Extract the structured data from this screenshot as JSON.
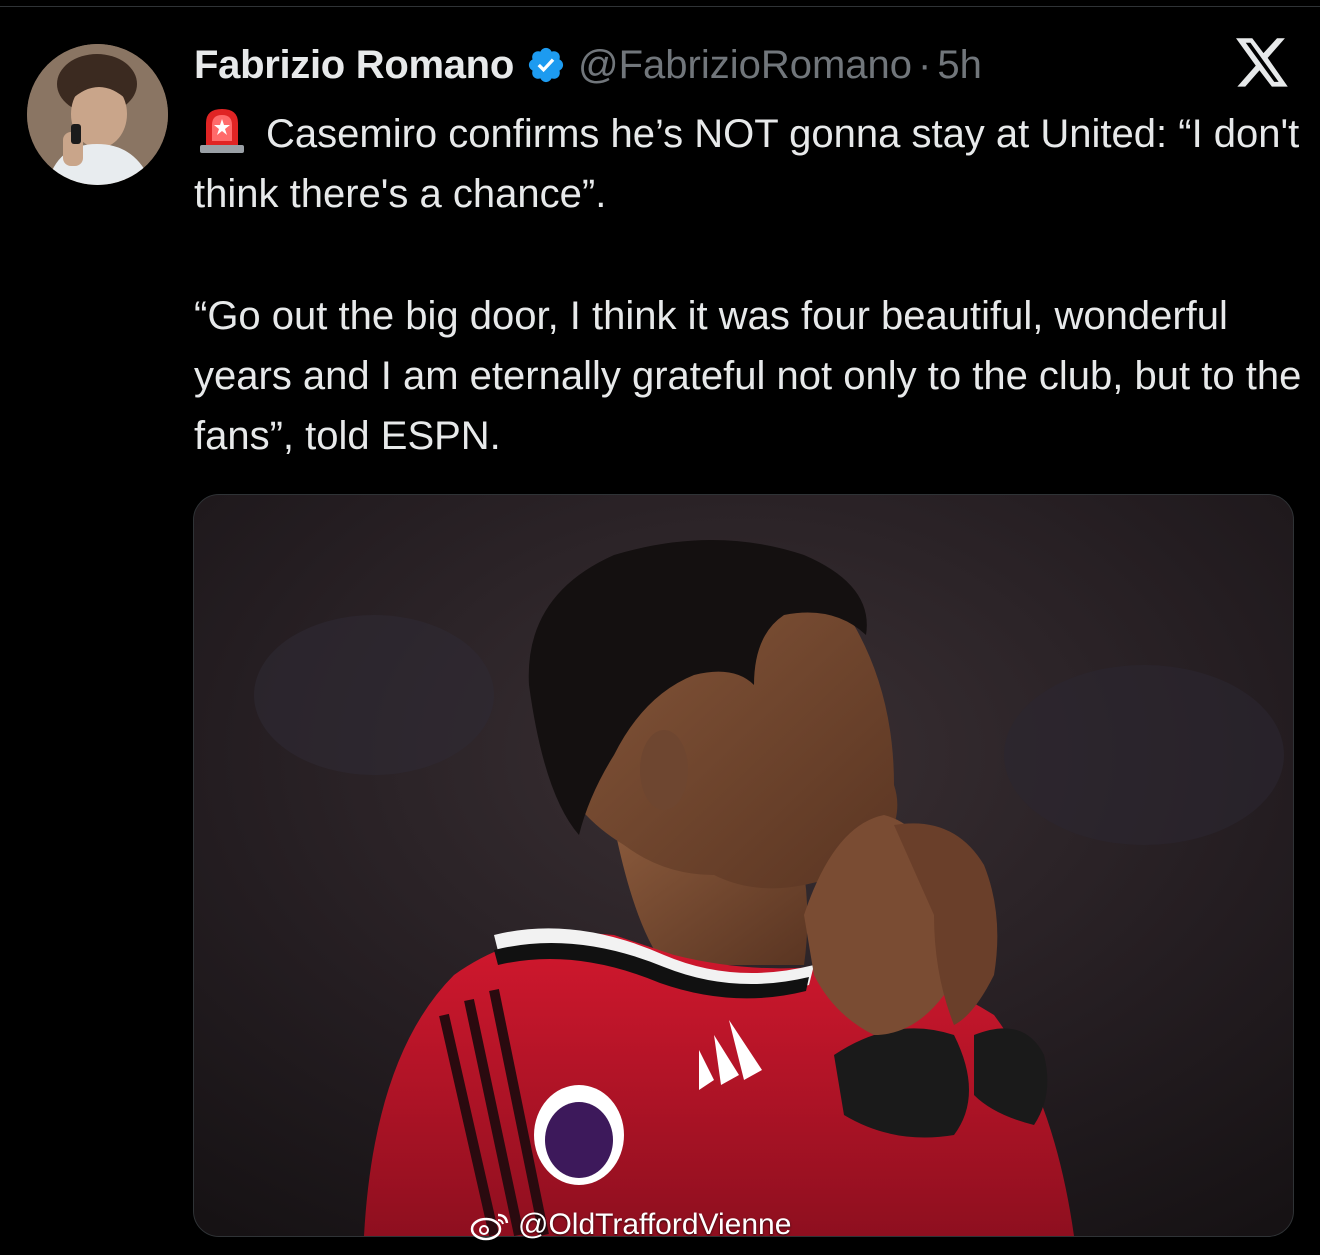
{
  "tweet": {
    "author": {
      "display_name": "Fabrizio Romano",
      "handle": "@FabrizioRomano",
      "separator": "·",
      "time": "5h",
      "verified": true,
      "avatar_icon": "avatar"
    },
    "platform_icon": "x-logo-icon",
    "emoji_icon": "police-siren-icon",
    "text_line_1": "Casemiro confirms he’s NOT gonna stay at United: “I don't think there's a chance”.",
    "text_line_2": "“Go out the big door, I think it was four beautiful, wonderful years and I am eternally grateful not only to the club, but to the fans”, told ESPN.",
    "media": {
      "watermark": "@OldTraffordVienne",
      "watermark_icon": "weibo-icon"
    }
  },
  "colors": {
    "background": "#000000",
    "text_primary": "#e7e9ea",
    "text_secondary": "#71767b",
    "verified_blue": "#1d9bf0",
    "jersey_red": "#c8102e"
  }
}
